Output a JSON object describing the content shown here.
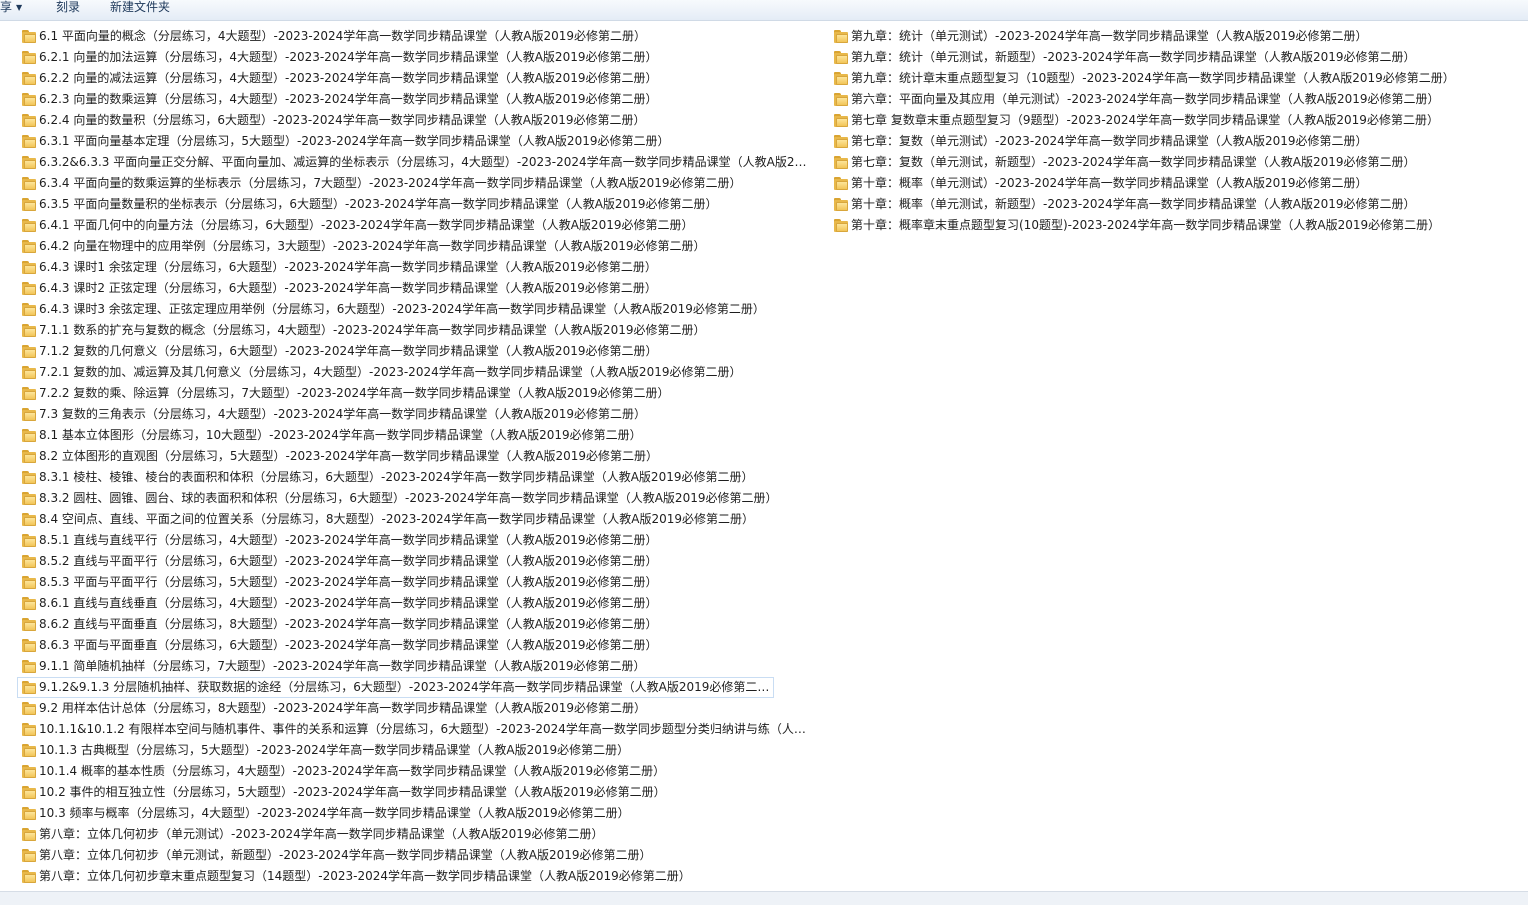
{
  "toolbar": {
    "share_label": "享",
    "burn_label": "刻录",
    "new_folder_label": "新建文件夹"
  },
  "icons": {
    "folder": "folder-icon",
    "dropdown": "caret-down-icon"
  },
  "colors": {
    "folder": "#f2c558",
    "selection_border": "#c9ddf3",
    "toolbar_text": "#1e395b"
  },
  "left_items": [
    "6.1 平面向量的概念（分层练习，4大题型）-2023-2024学年高一数学同步精品课堂（人教A版2019必修第二册）",
    "6.2.1 向量的加法运算（分层练习，4大题型）-2023-2024学年高一数学同步精品课堂（人教A版2019必修第二册）",
    "6.2.2 向量的减法运算（分层练习，4大题型）-2023-2024学年高一数学同步精品课堂（人教A版2019必修第二册）",
    "6.2.3 向量的数乘运算（分层练习，4大题型）-2023-2024学年高一数学同步精品课堂（人教A版2019必修第二册）",
    "6.2.4 向量的数量积（分层练习，6大题型）-2023-2024学年高一数学同步精品课堂（人教A版2019必修第二册）",
    "6.3.1 平面向量基本定理（分层练习，5大题型）-2023-2024学年高一数学同步精品课堂（人教A版2019必修第二册）",
    "6.3.2&6.3.3 平面向量正交分解、平面向量加、减运算的坐标表示（分层练习，4大题型）-2023-2024学年高一数学同步精品课堂（人教A版201...",
    "6.3.4 平面向量的数乘运算的坐标表示（分层练习，7大题型）-2023-2024学年高一数学同步精品课堂（人教A版2019必修第二册）",
    "6.3.5 平面向量数量积的坐标表示（分层练习，6大题型）-2023-2024学年高一数学同步精品课堂（人教A版2019必修第二册）",
    "6.4.1 平面几何中的向量方法（分层练习，6大题型）-2023-2024学年高一数学同步精品课堂（人教A版2019必修第二册）",
    "6.4.2 向量在物理中的应用举例（分层练习，3大题型）-2023-2024学年高一数学同步精品课堂（人教A版2019必修第二册）",
    "6.4.3 课时1 余弦定理（分层练习，6大题型）-2023-2024学年高一数学同步精品课堂（人教A版2019必修第二册）",
    "6.4.3 课时2 正弦定理（分层练习，6大题型）-2023-2024学年高一数学同步精品课堂（人教A版2019必修第二册）",
    "6.4.3 课时3 余弦定理、正弦定理应用举例（分层练习，6大题型）-2023-2024学年高一数学同步精品课堂（人教A版2019必修第二册）",
    "7.1.1 数系的扩充与复数的概念（分层练习，4大题型）-2023-2024学年高一数学同步精品课堂（人教A版2019必修第二册）",
    "7.1.2 复数的几何意义（分层练习，6大题型）-2023-2024学年高一数学同步精品课堂（人教A版2019必修第二册）",
    "7.2.1 复数的加、减运算及其几何意义（分层练习，4大题型）-2023-2024学年高一数学同步精品课堂（人教A版2019必修第二册）",
    "7.2.2 复数的乘、除运算（分层练习，7大题型）-2023-2024学年高一数学同步精品课堂（人教A版2019必修第二册）",
    "7.3 复数的三角表示（分层练习，4大题型）-2023-2024学年高一数学同步精品课堂（人教A版2019必修第二册）",
    "8.1 基本立体图形（分层练习，10大题型）-2023-2024学年高一数学同步精品课堂（人教A版2019必修第二册）",
    "8.2 立体图形的直观图（分层练习，5大题型）-2023-2024学年高一数学同步精品课堂（人教A版2019必修第二册）",
    "8.3.1 棱柱、棱锥、棱台的表面积和体积（分层练习，6大题型）-2023-2024学年高一数学同步精品课堂（人教A版2019必修第二册）",
    "8.3.2 圆柱、圆锥、圆台、球的表面积和体积（分层练习，6大题型）-2023-2024学年高一数学同步精品课堂（人教A版2019必修第二册）",
    "8.4 空间点、直线、平面之间的位置关系（分层练习，8大题型）-2023-2024学年高一数学同步精品课堂（人教A版2019必修第二册）",
    "8.5.1 直线与直线平行（分层练习，4大题型）-2023-2024学年高一数学同步精品课堂（人教A版2019必修第二册）",
    "8.5.2 直线与平面平行（分层练习，6大题型）-2023-2024学年高一数学同步精品课堂（人教A版2019必修第二册）",
    "8.5.3 平面与平面平行（分层练习，5大题型）-2023-2024学年高一数学同步精品课堂（人教A版2019必修第二册）",
    "8.6.1 直线与直线垂直（分层练习，4大题型）-2023-2024学年高一数学同步精品课堂（人教A版2019必修第二册）",
    "8.6.2 直线与平面垂直（分层练习，8大题型）-2023-2024学年高一数学同步精品课堂（人教A版2019必修第二册）",
    "8.6.3 平面与平面垂直（分层练习，6大题型）-2023-2024学年高一数学同步精品课堂（人教A版2019必修第二册）",
    "9.1.1 简单随机抽样（分层练习，7大题型）-2023-2024学年高一数学同步精品课堂（人教A版2019必修第二册）",
    "9.1.2&9.1.3 分层随机抽样、获取数据的途经（分层练习，6大题型）-2023-2024学年高一数学同步精品课堂（人教A版2019必修第二册）",
    "9.2 用样本估计总体（分层练习，8大题型）-2023-2024学年高一数学同步精品课堂（人教A版2019必修第二册）",
    "10.1.1&10.1.2 有限样本空间与随机事件、事件的关系和运算（分层练习，6大题型）-2023-2024学年高一数学同步题型分类归纳讲与练（人教A...",
    "10.1.3 古典概型（分层练习，5大题型）-2023-2024学年高一数学同步精品课堂（人教A版2019必修第二册）",
    "10.1.4 概率的基本性质（分层练习，4大题型）-2023-2024学年高一数学同步精品课堂（人教A版2019必修第二册）",
    "10.2 事件的相互独立性（分层练习，5大题型）-2023-2024学年高一数学同步精品课堂（人教A版2019必修第二册）",
    "10.3 频率与概率（分层练习，4大题型）-2023-2024学年高一数学同步精品课堂（人教A版2019必修第二册）",
    "第八章：立体几何初步（单元测试）-2023-2024学年高一数学同步精品课堂（人教A版2019必修第二册）",
    "第八章：立体几何初步（单元测试，新题型）-2023-2024学年高一数学同步精品课堂（人教A版2019必修第二册）",
    "第八章：立体几何初步章末重点题型复习（14题型）-2023-2024学年高一数学同步精品课堂（人教A版2019必修第二册）"
  ],
  "right_items": [
    "第九章：统计（单元测试）-2023-2024学年高一数学同步精品课堂（人教A版2019必修第二册）",
    "第九章：统计（单元测试，新题型）-2023-2024学年高一数学同步精品课堂（人教A版2019必修第二册）",
    "第九章：统计章末重点题型复习（10题型）-2023-2024学年高一数学同步精品课堂（人教A版2019必修第二册）",
    "第六章：平面向量及其应用（单元测试）-2023-2024学年高一数学同步精品课堂（人教A版2019必修第二册）",
    "第七章 复数章末重点题型复习（9题型）-2023-2024学年高一数学同步精品课堂（人教A版2019必修第二册）",
    "第七章：复数（单元测试）-2023-2024学年高一数学同步精品课堂（人教A版2019必修第二册）",
    "第七章：复数（单元测试，新题型）-2023-2024学年高一数学同步精品课堂（人教A版2019必修第二册）",
    "第十章：概率（单元测试）-2023-2024学年高一数学同步精品课堂（人教A版2019必修第二册）",
    "第十章：概率（单元测试，新题型）-2023-2024学年高一数学同步精品课堂（人教A版2019必修第二册）",
    "第十章：概率章末重点题型复习(10题型)-2023-2024学年高一数学同步精品课堂（人教A版2019必修第二册）"
  ],
  "selected_left_index": 31
}
